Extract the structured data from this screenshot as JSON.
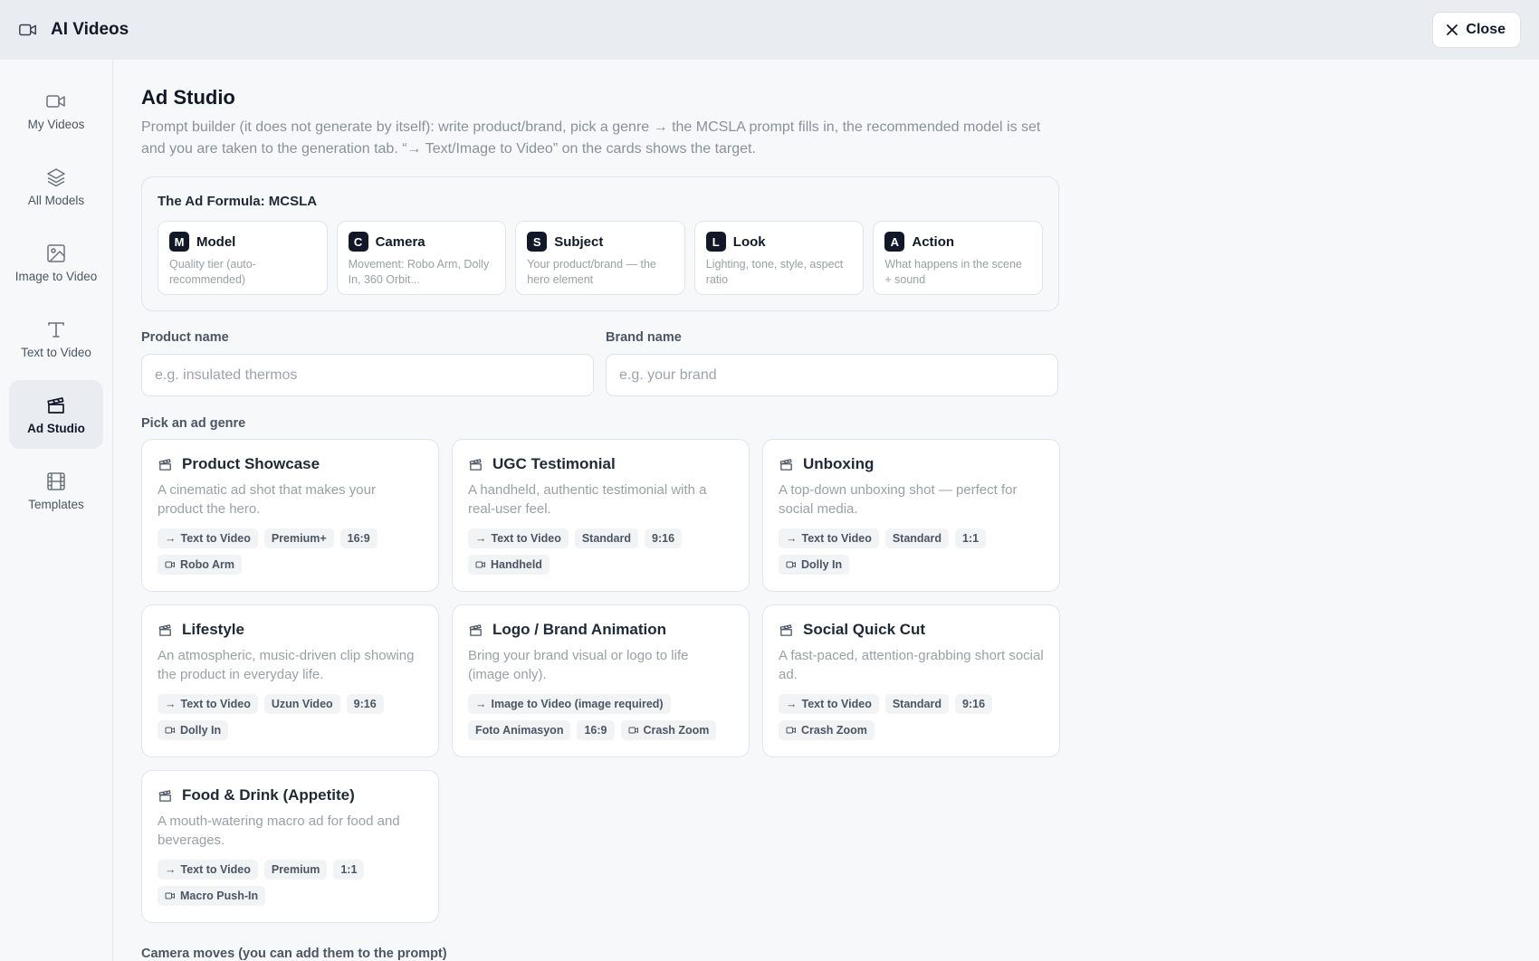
{
  "header": {
    "title": "AI Videos",
    "close_label": "Close"
  },
  "sidebar": {
    "items": [
      {
        "label": "My Videos",
        "icon": "video-camera-icon",
        "active": false
      },
      {
        "label": "All Models",
        "icon": "layers-icon",
        "active": false
      },
      {
        "label": "Image to Video",
        "icon": "image-icon",
        "active": false
      },
      {
        "label": "Text to Video",
        "icon": "text-icon",
        "active": false
      },
      {
        "label": "Ad Studio",
        "icon": "clapperboard-icon",
        "active": true
      },
      {
        "label": "Templates",
        "icon": "film-icon",
        "active": false
      }
    ]
  },
  "main": {
    "title": "Ad Studio",
    "description": "Prompt builder (it does not generate by itself): write product/brand, pick a genre → the MCSLA prompt fills in, the recommended model is set and you are taken to the generation tab. “→ Text/Image to Video” on the cards shows the target.",
    "formula": {
      "title": "The Ad Formula: MCSLA",
      "items": [
        {
          "letter": "M",
          "name": "Model",
          "desc": "Quality tier (auto-recommended)"
        },
        {
          "letter": "C",
          "name": "Camera",
          "desc": "Movement: Robo Arm, Dolly In, 360 Orbit..."
        },
        {
          "letter": "S",
          "name": "Subject",
          "desc": "Your product/brand — the hero element"
        },
        {
          "letter": "L",
          "name": "Look",
          "desc": "Lighting, tone, style, aspect ratio"
        },
        {
          "letter": "A",
          "name": "Action",
          "desc": "What happens in the scene + sound"
        }
      ]
    },
    "product": {
      "label": "Product name",
      "placeholder": "e.g. insulated thermos"
    },
    "brand": {
      "label": "Brand name",
      "placeholder": "e.g. your brand"
    },
    "genre_label": "Pick an ad genre",
    "genres": [
      {
        "title": "Product Showcase",
        "desc": "A cinematic ad shot that makes your product the hero.",
        "target": "Text to Video",
        "tier": "Premium+",
        "ratio": "16:9",
        "camera": "Robo Arm"
      },
      {
        "title": "UGC Testimonial",
        "desc": "A handheld, authentic testimonial with a real-user feel.",
        "target": "Text to Video",
        "tier": "Standard",
        "ratio": "9:16",
        "camera": "Handheld"
      },
      {
        "title": "Unboxing",
        "desc": "A top-down unboxing shot — perfect for social media.",
        "target": "Text to Video",
        "tier": "Standard",
        "ratio": "1:1",
        "camera": "Dolly In"
      },
      {
        "title": "Lifestyle",
        "desc": "An atmospheric, music-driven clip showing the product in everyday life.",
        "target": "Text to Video",
        "tier": "Uzun Video",
        "ratio": "9:16",
        "camera": "Dolly In"
      },
      {
        "title": "Logo / Brand Animation",
        "desc": "Bring your brand visual or logo to life (image only).",
        "target": "Image to Video (image required)",
        "tier": "Foto Animasyon",
        "ratio": "16:9",
        "camera": "Crash Zoom"
      },
      {
        "title": "Social Quick Cut",
        "desc": "A fast-paced, attention-grabbing short social ad.",
        "target": "Text to Video",
        "tier": "Standard",
        "ratio": "9:16",
        "camera": "Crash Zoom"
      },
      {
        "title": "Food & Drink (Appetite)",
        "desc": "A mouth-watering macro ad for food and beverages.",
        "target": "Text to Video",
        "tier": "Premium",
        "ratio": "1:1",
        "camera": "Macro Push-In"
      }
    ],
    "camera_section_label": "Camera moves (you can add them to the prompt)"
  }
}
